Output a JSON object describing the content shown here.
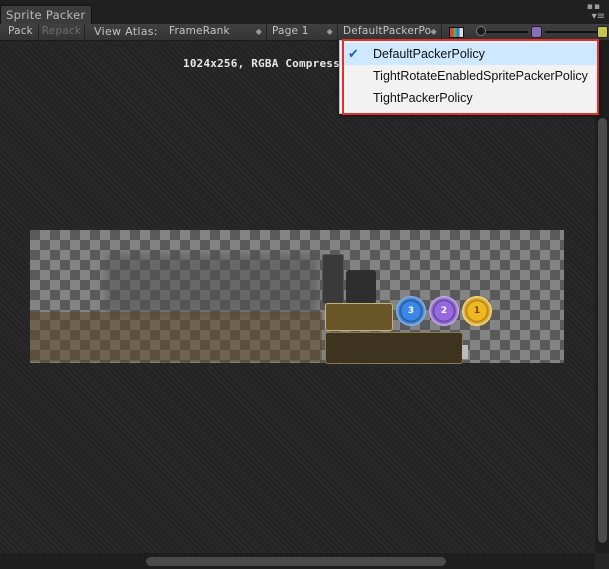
{
  "window": {
    "tab_title": "Sprite Packer"
  },
  "toolbar": {
    "pack_label": "Pack",
    "repack_label": "Repack",
    "view_atlas_label": "View Atlas:",
    "atlas_dropdown": "FrameRank",
    "page_dropdown": "Page 1",
    "policy_dropdown": "DefaultPackerPo"
  },
  "canvas": {
    "atlas_info": "1024x256, RGBA Compressed"
  },
  "medals": [
    "3",
    "2",
    "1"
  ],
  "policy_menu": {
    "items": [
      {
        "label": "DefaultPackerPolicy",
        "checked": true
      },
      {
        "label": "TightRotateEnabledSpritePackerPolicy",
        "checked": false
      },
      {
        "label": "TightPackerPolicy",
        "checked": false
      }
    ]
  },
  "colors": {
    "highlight_border": "#e0302c",
    "menu_selected": "#cde8ff",
    "checkmark": "#1a5fb4"
  }
}
